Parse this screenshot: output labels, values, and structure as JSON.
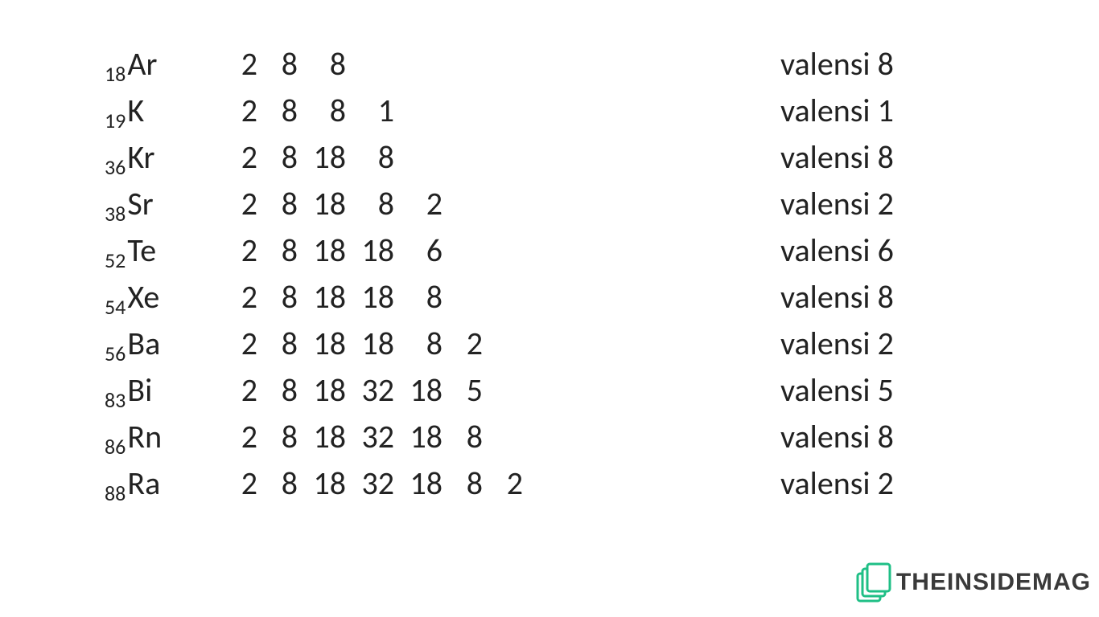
{
  "rows": [
    {
      "atomic_number": "18",
      "symbol": "Ar",
      "shells": [
        2,
        8,
        8
      ],
      "valence_label": "valensi 8"
    },
    {
      "atomic_number": "19",
      "symbol": "K",
      "shells": [
        2,
        8,
        8,
        1
      ],
      "valence_label": "valensi 1"
    },
    {
      "atomic_number": "36",
      "symbol": "Kr",
      "shells": [
        2,
        8,
        18,
        8
      ],
      "valence_label": "valensi 8"
    },
    {
      "atomic_number": "38",
      "symbol": "Sr",
      "shells": [
        2,
        8,
        18,
        8,
        2
      ],
      "valence_label": "valensi 2"
    },
    {
      "atomic_number": "52",
      "symbol": "Te",
      "shells": [
        2,
        8,
        18,
        18,
        6
      ],
      "valence_label": "valensi 6"
    },
    {
      "atomic_number": "54",
      "symbol": "Xe",
      "shells": [
        2,
        8,
        18,
        18,
        8
      ],
      "valence_label": "valensi 8"
    },
    {
      "atomic_number": "56",
      "symbol": "Ba",
      "shells": [
        2,
        8,
        18,
        18,
        8,
        2
      ],
      "valence_label": "valensi 2"
    },
    {
      "atomic_number": "83",
      "symbol": "Bi",
      "shells": [
        2,
        8,
        18,
        32,
        18,
        5
      ],
      "valence_label": "valensi 5"
    },
    {
      "atomic_number": "86",
      "symbol": "Rn",
      "shells": [
        2,
        8,
        18,
        32,
        18,
        8
      ],
      "valence_label": "valensi 8"
    },
    {
      "atomic_number": "88",
      "symbol": "Ra",
      "shells": [
        2,
        8,
        18,
        32,
        18,
        8,
        2
      ],
      "valence_label": "valensi 2"
    }
  ],
  "watermark": {
    "text": "THEINSIDEMAG",
    "color": "#1fbf86"
  }
}
